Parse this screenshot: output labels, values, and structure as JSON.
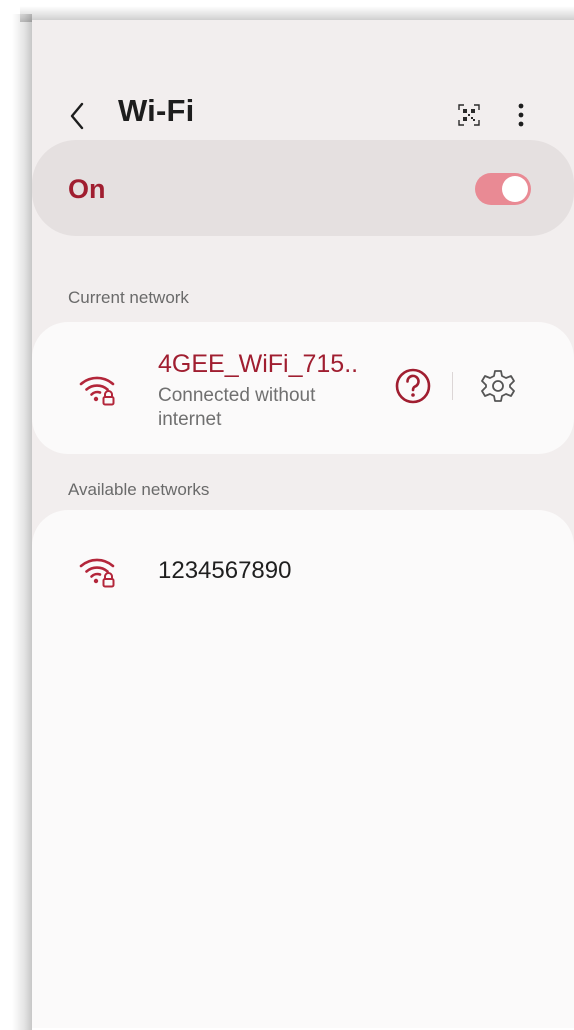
{
  "header": {
    "title": "Wi-Fi",
    "back_icon": "chevron-left-icon",
    "qr_icon": "qr-code-scan-icon",
    "more_icon": "more-vertical-icon"
  },
  "wifi_toggle": {
    "label": "On",
    "state": "on"
  },
  "current_network": {
    "section_label": "Current network",
    "name": "4GEE_WiFi_715..",
    "status": "Connected without internet",
    "icon": "wifi-lock-icon",
    "help_icon": "question-circle-icon",
    "settings_icon": "gear-icon"
  },
  "available_networks": {
    "section_label": "Available networks",
    "items": [
      {
        "name": "1234567890",
        "icon": "wifi-lock-icon"
      }
    ]
  },
  "colors": {
    "accent": "#a01e30",
    "toggle_track": "#e98a94",
    "background": "#f2eeee",
    "card": "#fbfafa"
  }
}
